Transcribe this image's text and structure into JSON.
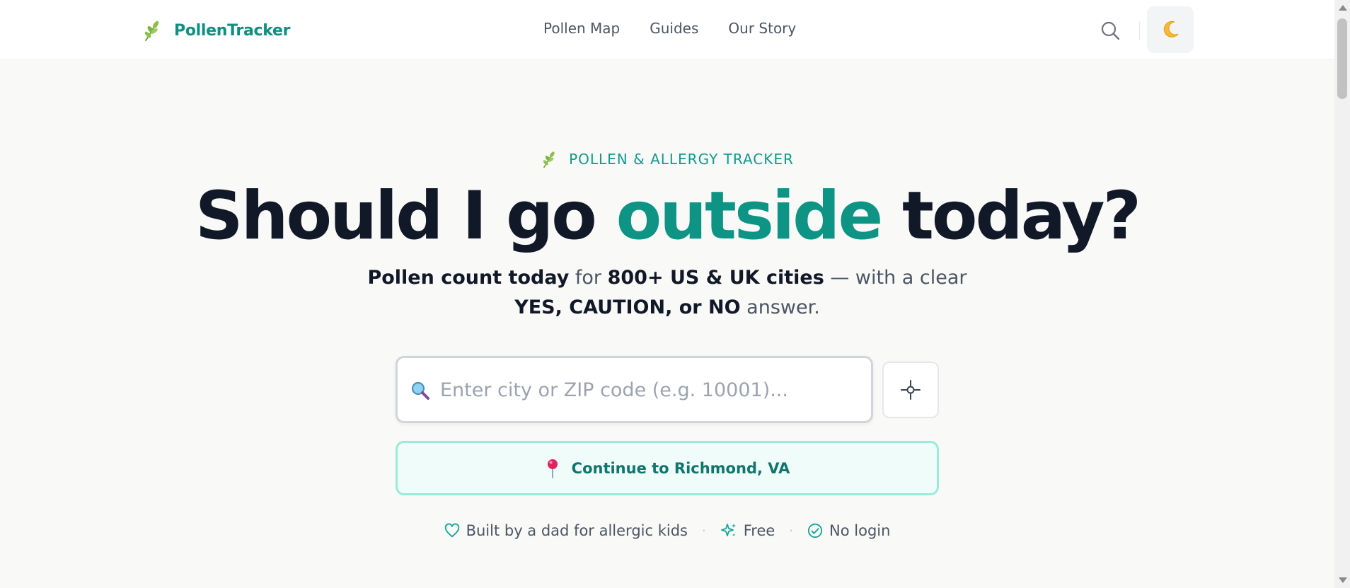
{
  "header": {
    "brand": "PollenTracker",
    "nav": [
      "Pollen Map",
      "Guides",
      "Our Story"
    ]
  },
  "hero": {
    "eyebrow": "POLLEN & ALLERGY TRACKER",
    "headline": {
      "before": "Should I go ",
      "accent": "outside",
      "after": " today?"
    },
    "subhead": {
      "part1_bold": "Pollen count today",
      "part2": " for ",
      "part3_bold": "800+ US & UK cities",
      "part4": " — with a clear",
      "part5_bold": "YES, CAUTION, or NO",
      "part6": " answer."
    }
  },
  "search": {
    "placeholder": "Enter city or ZIP code (e.g. 10001)..."
  },
  "continue": {
    "label": "Continue to Richmond, VA"
  },
  "trust": {
    "item1": "Built by a dad for allergic kids",
    "item2": "Free",
    "item3": "No login"
  },
  "colors": {
    "brand": "#0f8f80",
    "accent": "#0d9485",
    "continue_bg": "#effcf9",
    "continue_border": "#99ecd9"
  },
  "icons": {
    "brand": "herb-leaf-icon",
    "search": "magnifier-icon",
    "theme": "crescent-moon-icon",
    "locate": "crosshair-icon",
    "continue": "pin-icon",
    "trust": [
      "heart-icon",
      "sparkles-icon",
      "check-circle-icon"
    ]
  }
}
